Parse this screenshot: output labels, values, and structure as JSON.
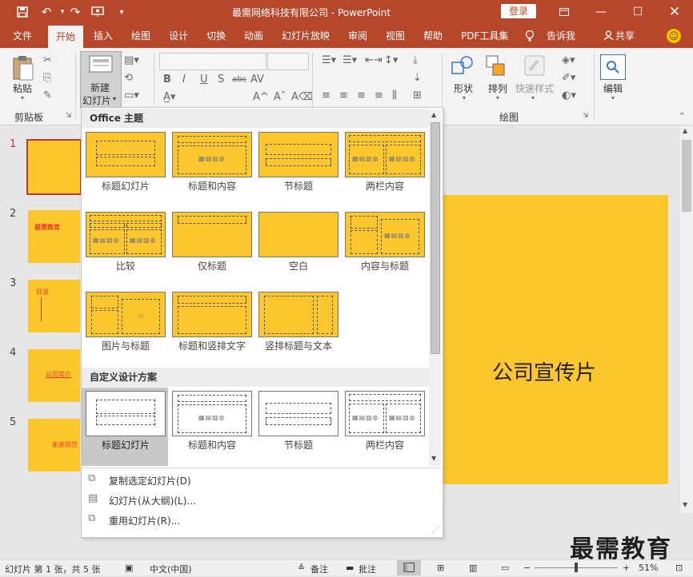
{
  "window": {
    "title": "最需网络科技有限公司  -  PowerPoint",
    "login_label": "登录"
  },
  "quick_access": {
    "save_icon": "save-icon",
    "undo_icon": "undo-icon",
    "redo_icon": "redo-icon",
    "present_icon": "present-icon",
    "customize_icon": "customize-icon"
  },
  "tabs": [
    {
      "label": "文件"
    },
    {
      "label": "开始"
    },
    {
      "label": "插入"
    },
    {
      "label": "绘图"
    },
    {
      "label": "设计"
    },
    {
      "label": "切换"
    },
    {
      "label": "动画"
    },
    {
      "label": "幻灯片放映"
    },
    {
      "label": "审阅"
    },
    {
      "label": "视图"
    },
    {
      "label": "帮助"
    },
    {
      "label": "PDF工具集"
    },
    {
      "label": "告诉我"
    },
    {
      "label": "共享"
    }
  ],
  "ribbon": {
    "paste_label": "粘贴",
    "clipboard_group": "剪贴板",
    "new_slide_line1": "新建",
    "new_slide_line2": "幻灯片",
    "shapes_label": "形状",
    "arrange_label": "排列",
    "quick_styles_label": "快速样式",
    "drawing_group": "绘图",
    "edit_label": "编辑",
    "font_buttons": [
      "B",
      "I",
      "U",
      "S",
      "abc",
      "AV"
    ]
  },
  "slides": [
    {
      "number": "1",
      "text": ""
    },
    {
      "number": "2",
      "text": "最需教育"
    },
    {
      "number": "3",
      "text": "目录"
    },
    {
      "number": "4",
      "text": "公司简介"
    },
    {
      "number": "5",
      "text": "谢谢观赏"
    }
  ],
  "main_slide": {
    "title": "公司宣传片"
  },
  "dropdown": {
    "office_section": "Office 主题",
    "custom_section": "自定义设计方案",
    "office_layouts": [
      {
        "label": "标题幻灯片"
      },
      {
        "label": "标题和内容"
      },
      {
        "label": "节标题"
      },
      {
        "label": "两栏内容"
      },
      {
        "label": "比较"
      },
      {
        "label": "仅标题"
      },
      {
        "label": "空白"
      },
      {
        "label": "内容与标题"
      },
      {
        "label": "图片与标题"
      },
      {
        "label": "标题和竖排文字"
      },
      {
        "label": "竖排标题与文本"
      }
    ],
    "custom_layouts": [
      {
        "label": "标题幻灯片"
      },
      {
        "label": "标题和内容"
      },
      {
        "label": "节标题"
      },
      {
        "label": "两栏内容"
      }
    ],
    "menu": [
      {
        "label": "复制选定幻灯片(D)",
        "icon": "duplicate-slide-icon"
      },
      {
        "label": "幻灯片(从大纲)(L)...",
        "icon": "outline-slide-icon"
      },
      {
        "label": "重用幻灯片(R)...",
        "icon": "reuse-slide-icon"
      }
    ]
  },
  "status": {
    "slide_info": "幻灯片 第 1 张，共 5 张",
    "language": "中文(中国)",
    "notes": "备注",
    "comments": "批注",
    "zoom": "51%"
  },
  "watermark": "最需教育",
  "colors": {
    "accent": "#b7472a",
    "slide_bg": "#fcc62d"
  }
}
